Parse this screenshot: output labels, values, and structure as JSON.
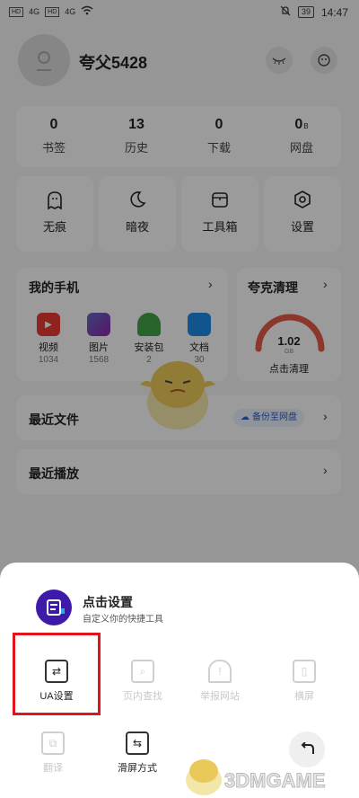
{
  "status_bar": {
    "sim1": "HD",
    "sim2": "HD",
    "signal_left": "4G",
    "signal_right": "4G",
    "battery": "39",
    "time": "14:47"
  },
  "profile": {
    "username": "夸父5428"
  },
  "stats": [
    {
      "num": "0",
      "label": "书签"
    },
    {
      "num": "13",
      "label": "历史"
    },
    {
      "num": "0",
      "label": "下载"
    },
    {
      "num": "0",
      "label": "网盘",
      "unit": "B"
    }
  ],
  "tools": [
    {
      "label": "无痕",
      "icon": "ghost-icon"
    },
    {
      "label": "暗夜",
      "icon": "moon-icon"
    },
    {
      "label": "工具箱",
      "icon": "toolbox-icon"
    },
    {
      "label": "设置",
      "icon": "hexagon-gear-icon"
    }
  ],
  "my_phone": {
    "title": "我的手机",
    "apps": [
      {
        "label": "视频",
        "count": "1034",
        "color": "#e53935"
      },
      {
        "label": "图片",
        "count": "1568",
        "color": "#3f51b5"
      },
      {
        "label": "安装包",
        "count": "2",
        "color": "#43a047"
      },
      {
        "label": "文档",
        "count": "30",
        "color": "#1e88e5"
      }
    ]
  },
  "cleaner": {
    "title": "夸克清理",
    "value": "1.02",
    "unit": "GB",
    "action": "点击清理"
  },
  "recent_files": {
    "title": "最近文件",
    "backup": "备份至网盘"
  },
  "recent_play": {
    "title": "最近播放"
  },
  "sheet": {
    "title": "点击设置",
    "subtitle": "自定义你的快捷工具",
    "options": [
      {
        "label": "UA设置",
        "enabled": true,
        "icon": "ua-swap-icon"
      },
      {
        "label": "页内查找",
        "enabled": false,
        "icon": "find-in-page-icon"
      },
      {
        "label": "举报网站",
        "enabled": false,
        "icon": "report-alarm-icon"
      },
      {
        "label": "横屏",
        "enabled": false,
        "icon": "rotate-screen-icon"
      },
      {
        "label": "翻译",
        "enabled": false,
        "icon": "translate-icon"
      },
      {
        "label": "滑屏方式",
        "enabled": true,
        "icon": "swipe-mode-icon"
      }
    ]
  },
  "watermark": "3DMGAME",
  "colors": {
    "accent": "#3d1aa8",
    "highlight": "#e0141a",
    "cleaner_arc": "#e05a4a"
  }
}
